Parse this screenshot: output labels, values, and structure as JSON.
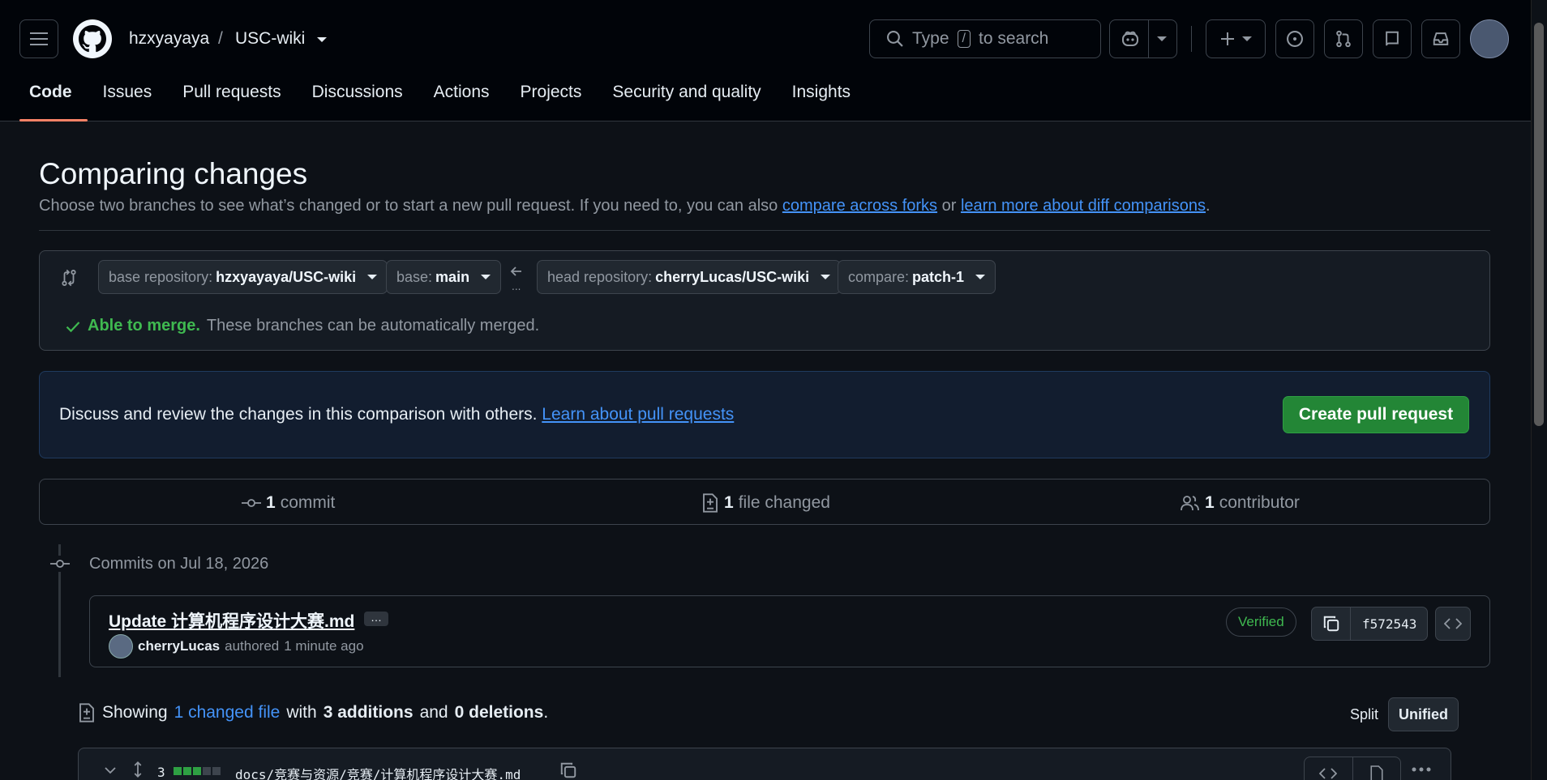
{
  "header": {
    "owner": "hzxyayaya",
    "separator": "/",
    "repo": "USC-wiki",
    "search_prefix": "Type",
    "search_key": "/",
    "search_suffix": "to search"
  },
  "tabs": [
    {
      "label": "Code"
    },
    {
      "label": "Issues"
    },
    {
      "label": "Pull requests"
    },
    {
      "label": "Discussions"
    },
    {
      "label": "Actions"
    },
    {
      "label": "Projects"
    },
    {
      "label": "Security and quality"
    },
    {
      "label": "Insights"
    }
  ],
  "page": {
    "title": "Comparing changes",
    "subtitle_start": "Choose two branches to see what’s changed or to start a new pull request. If you need to, you can also",
    "link_forks": "compare across forks",
    "or": "or",
    "link_learn": "learn more about diff comparisons",
    "period": "."
  },
  "range": {
    "base_repo_label": "base repository:",
    "base_repo_value": "hzxyayaya/USC-wiki",
    "base_label": "base:",
    "base_value": "main",
    "head_repo_label": "head repository:",
    "head_repo_value": "cherryLucas/USC-wiki",
    "compare_label": "compare:",
    "compare_value": "patch-1",
    "merge_status": "Able to merge.",
    "merge_detail": "These branches can be automatically merged."
  },
  "discuss": {
    "text": "Discuss and review the changes in this comparison with others.",
    "link": "Learn about pull requests",
    "button": "Create pull request"
  },
  "stats": {
    "commits_n": "1",
    "commits_label": "commit",
    "files_n": "1",
    "files_label": "file changed",
    "contributors_n": "1",
    "contributors_label": "contributor"
  },
  "commits": {
    "day": "Commits on Jul 18, 2026",
    "message": "Update 计算机程序设计大赛.md",
    "ellipsis": "…",
    "author": "cherryLucas",
    "authored": "authored",
    "time": "1 minute ago",
    "verified": "Verified",
    "sha": "f572543"
  },
  "diff": {
    "showing": "Showing",
    "changed_link": "1 changed file",
    "with": "with",
    "additions": "3 additions",
    "and": "and",
    "deletions": "0 deletions",
    "period": ".",
    "split": "Split",
    "unified": "Unified",
    "file_changes": "3",
    "file_path": "docs/竞赛与资源/竞赛/计算机程序设计大赛.md"
  }
}
